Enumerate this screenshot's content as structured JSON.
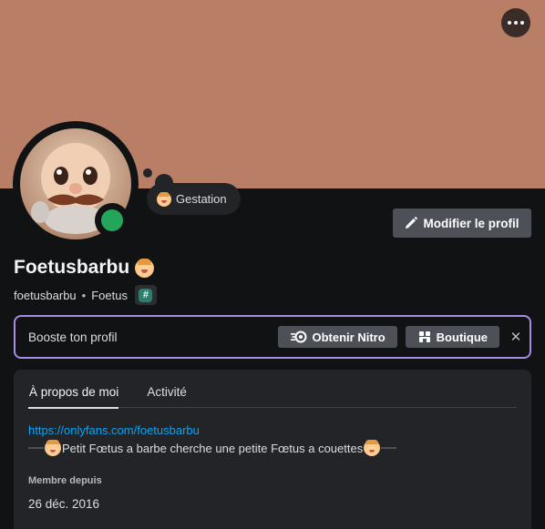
{
  "profile": {
    "display_name": "Foetusbarbu",
    "username": "foetusbarbu",
    "pronoun_or_tag": "Foetus",
    "badge": "#",
    "status_text": "Gestation",
    "online_color": "#23a55a",
    "banner_color": "#b97f66"
  },
  "actions": {
    "more_label": "...",
    "edit_profile": "Modifier le profil"
  },
  "boost": {
    "text": "Booste ton profil",
    "nitro_button": "Obtenir Nitro",
    "shop_button": "Boutique",
    "close_label": "✕",
    "accent_color": "#a98be8"
  },
  "about": {
    "tabs": [
      "À propos de moi",
      "Activité"
    ],
    "link": "https://onlyfans.com/foetusbarbu",
    "bio": "Petit Fœtus a barbe cherche une petite Fœtus a couettes",
    "member_since_label": "Membre depuis",
    "member_since_date": "26 déc. 2016"
  },
  "icons": {
    "more": "more-horizontal-icon",
    "edit": "pencil-icon",
    "nitro": "nitro-icon",
    "shop": "shop-icon",
    "close": "close-icon",
    "emoji": "baby-emoji-icon"
  }
}
